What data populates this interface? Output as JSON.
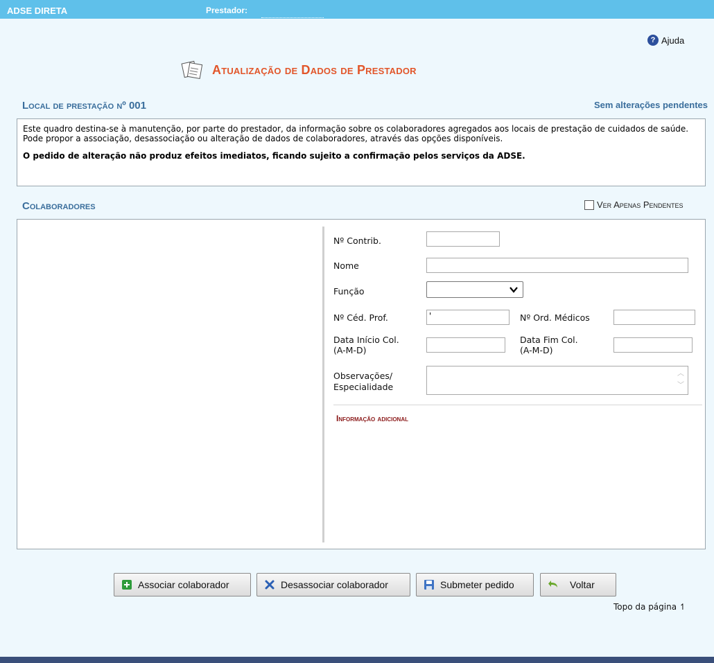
{
  "header": {
    "brand": "ADSE DIRETA",
    "prestador_label": "Prestador:"
  },
  "help": {
    "label": "Ajuda"
  },
  "page_title": {
    "main": "Atualização de Dados de Prestador"
  },
  "local": {
    "heading": "Local de prestação nº 001",
    "status": "Sem alterações pendentes"
  },
  "info": {
    "text": "Este quadro destina-se à manutenção, por parte do prestador, da informação sobre os colaboradores agregados aos locais de prestação de cuidados de saúde.  Pode propor a associação, desassociação ou alteração de dados de colaboradores, através das opções disponíveis.",
    "warning": "O pedido de alteração não produz efeitos imediatos, ficando sujeito a confirmação pelos serviços da ADSE."
  },
  "colaboradores": {
    "heading": "Colaboradores",
    "filter_label": "Ver Apenas Pendentes"
  },
  "form": {
    "contrib_label": "Nº Contrib.",
    "nome_label": "Nome",
    "funcao_label": "Função",
    "ced_prof_label": "Nº Céd. Prof.",
    "ced_prof_value": "'",
    "ord_medicos_label": "Nº Ord. Médicos",
    "data_inicio_label": "Data Início Col.",
    "data_fim_label": "Data Fim Col.",
    "date_format": "(A-M-D)",
    "obs_label_1": "Observações/",
    "obs_label_2": "Especialidade",
    "additional_info": "Informação adicional"
  },
  "buttons": {
    "associate": "Associar colaborador",
    "disassociate": "Desassociar colaborador",
    "submit": "Submeter pedido",
    "back": "Voltar"
  },
  "footer": {
    "top_link": "Topo da página",
    "top_arrow": "↿"
  },
  "colors": {
    "header_bg": "#5fc0ea",
    "title": "#e2562a",
    "section": "#3a6e9c",
    "add_info": "#8b1a1a",
    "bottom_bar": "#3a4f7a"
  }
}
